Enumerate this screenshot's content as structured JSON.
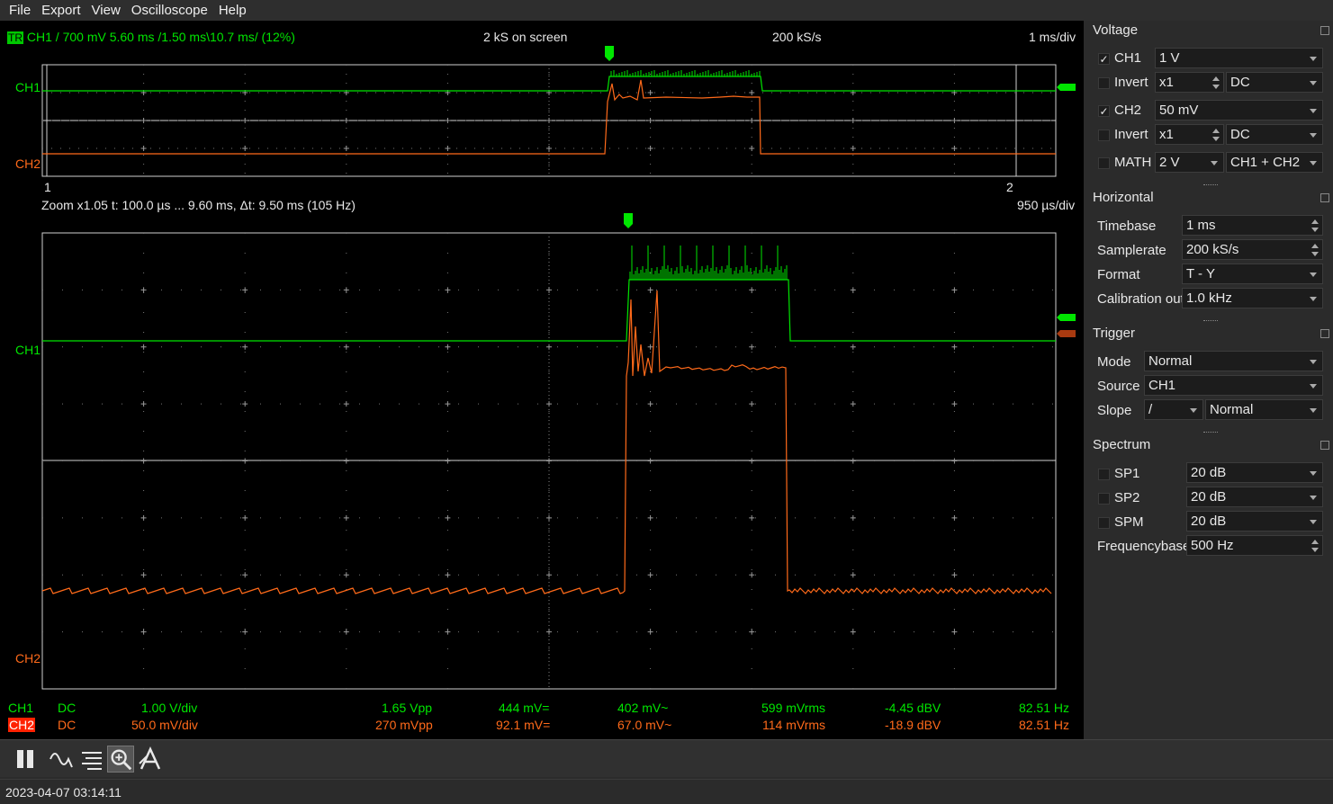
{
  "menu": [
    "File",
    "Export",
    "View",
    "Oscilloscope",
    "Help"
  ],
  "scope": {
    "trigger_badge": "TR",
    "trigger_info": "CH1  /  700 mV  5.60 ms  /1.50 ms\\10.7 ms/ (12%)",
    "samples_on_screen": "2 kS on screen",
    "samplerate": "200 kS/s",
    "timebase": "1 ms/div",
    "overview_marker_left": "1",
    "overview_marker_right": "2",
    "zoom_info": "Zoom x1.05   t: 100.0 µs ... 9.60 ms,  Δt: 9.50 ms (105 Hz)",
    "zoom_timebase": "950 µs/div",
    "ch1_label": "CH1",
    "ch2_label": "CH2",
    "ch1_color": "#00e600",
    "ch2_color": "#ff6a1a",
    "measurements": [
      {
        "name": "CH1",
        "coupling": "DC",
        "scale": "1.00 V/div",
        "vpp": "1.65 Vpp",
        "dc": "444 mV=",
        "ac": "402 mV~",
        "rms": "599 mVrms",
        "dbv": "-4.45 dBV",
        "freq": "82.51 Hz"
      },
      {
        "name": "CH2",
        "coupling": "DC",
        "scale": "50.0 mV/div",
        "vpp": "270 mVpp",
        "dc": "92.1 mV=",
        "ac": "67.0 mV~",
        "rms": "114 mVrms",
        "dbv": "-18.9 dBV",
        "freq": "82.51 Hz"
      }
    ]
  },
  "panel": {
    "voltage": {
      "title": "Voltage",
      "ch1": {
        "label": "CH1",
        "checked": "✓",
        "gain": "1 V",
        "invert_label": "Invert",
        "probe": "x1",
        "coupling": "DC"
      },
      "ch2": {
        "label": "CH2",
        "checked": "✓",
        "gain": "50 mV",
        "invert_label": "Invert",
        "probe": "x1",
        "coupling": "DC"
      },
      "math": {
        "label": "MATH",
        "gain": "2 V",
        "mode": "CH1 + CH2"
      }
    },
    "horizontal": {
      "title": "Horizontal",
      "timebase_label": "Timebase",
      "timebase": "1 ms",
      "samplerate_label": "Samplerate",
      "samplerate": "200 kS/s",
      "format_label": "Format",
      "format": "T - Y",
      "calibration_label": "Calibration out",
      "calibration": "1.0 kHz"
    },
    "trigger": {
      "title": "Trigger",
      "mode_label": "Mode",
      "mode": "Normal",
      "source_label": "Source",
      "source": "CH1",
      "slope_label": "Slope",
      "slope": "/",
      "slope_mode": "Normal"
    },
    "spectrum": {
      "title": "Spectrum",
      "sp1_label": "SP1",
      "sp1": "20 dB",
      "sp2_label": "SP2",
      "sp2": "20 dB",
      "spm_label": "SPM",
      "spm": "20 dB",
      "freqbase_label": "Frequencybase",
      "freqbase": "500 Hz"
    }
  },
  "toolbar": [
    "pause-icon",
    "waveform-icon",
    "measure-icon",
    "zoom-icon",
    "cursor-icon"
  ],
  "status": {
    "timestamp": "2023-04-07 03:14:11"
  }
}
